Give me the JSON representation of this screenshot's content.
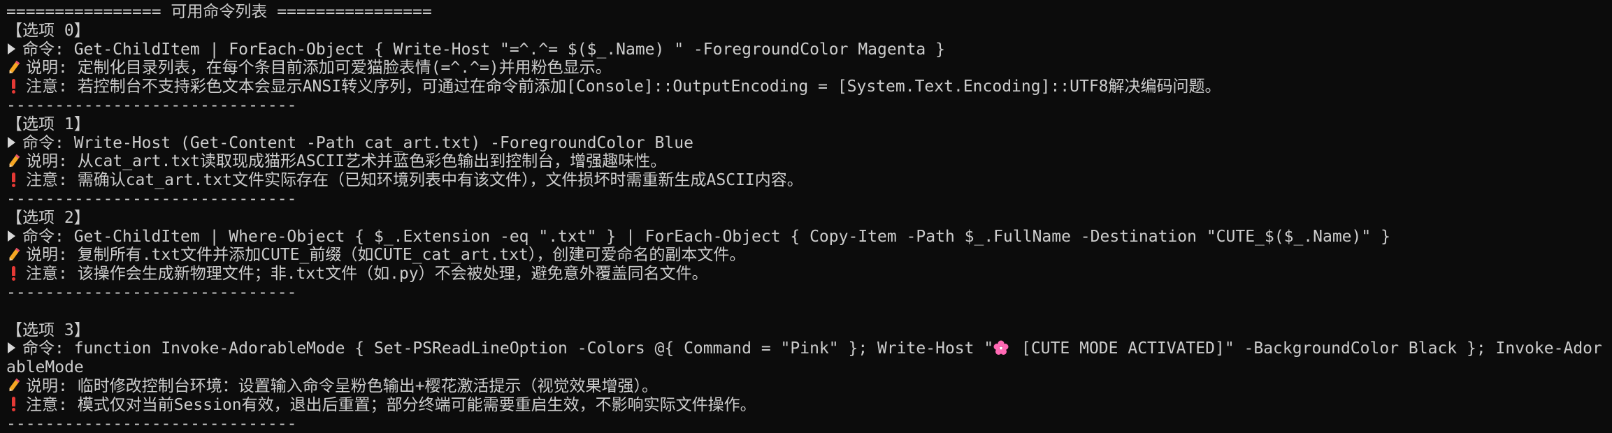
{
  "header": "================ 可用命令列表 ================",
  "separator": "------------------------------",
  "labels": {
    "command": "命令: ",
    "description": "说明: ",
    "note": "注意: "
  },
  "icons": {
    "command": "triangle-right-icon",
    "description": "pencil-icon",
    "note": "red-exclamation-icon",
    "flower": "cherry-blossom-icon"
  },
  "options": [
    {
      "title": "【选项 0】",
      "command": "Get-ChildItem | ForEach-Object { Write-Host \"=^.^= $($_.Name) \" -ForegroundColor Magenta }",
      "description": "定制化目录列表，在每个条目前添加可爱猫脸表情(=^.^=)并用粉色显示。",
      "note": "若控制台不支持彩色文本会显示ANSI转义序列，可通过在命令前添加[Console]::OutputEncoding = [System.Text.Encoding]::UTF8解决编码问题。"
    },
    {
      "title": "【选项 1】",
      "command": "Write-Host (Get-Content -Path cat_art.txt) -ForegroundColor Blue",
      "description": "从cat_art.txt读取现成猫形ASCII艺术并蓝色彩色输出到控制台，增强趣味性。",
      "note": "需确认cat_art.txt文件实际存在（已知环境列表中有该文件），文件损坏时需重新生成ASCII内容。"
    },
    {
      "title": "【选项 2】",
      "command": "Get-ChildItem | Where-Object { $_.Extension -eq \".txt\" } | ForEach-Object { Copy-Item -Path $_.FullName -Destination \"CUTE_$($_.Name)\" }",
      "description": "复制所有.txt文件并添加CUTE_前缀（如CUTE_cat_art.txt），创建可爱命名的副本文件。",
      "note": "该操作会生成新物理文件；非.txt文件（如.py）不会被处理，避免意外覆盖同名文件。"
    },
    {
      "title": "【选项 3】",
      "command_before": "function Invoke-AdorableMode { Set-PSReadLineOption -Colors @{ Command = \"Pink\" }; Write-Host \"",
      "command_after": " [CUTE MODE ACTIVATED]\" -BackgroundColor Black }; Invoke-AdorableMode",
      "description": "临时修改控制台环境：设置输入命令呈粉色输出+樱花激活提示（视觉效果增强）。",
      "note": "模式仅对当前Session有效，退出后重置；部分终端可能需要重启生效，不影响实际文件操作。"
    }
  ],
  "colors": {
    "background": "#0c0c0c",
    "text": "#cccccc",
    "flower": "#ff69b4",
    "bang": "#e53935"
  }
}
